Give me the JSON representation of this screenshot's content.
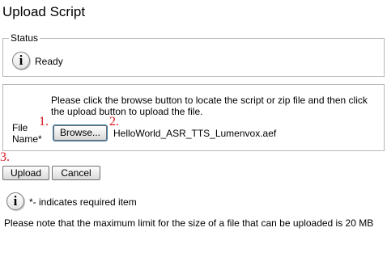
{
  "page": {
    "title": "Upload Script"
  },
  "status": {
    "legend": "Status",
    "text": "Ready"
  },
  "upload": {
    "instructions_line1": "Please click the browse button to locate the script or zip file and then click",
    "instructions_line2": "the upload button to upload the file.",
    "file_label_line1": "File",
    "file_label_line2": "Name*",
    "browse_label": "Browse...",
    "file_name": "HelloWorld_ASR_TTS_Lumenvox.aef"
  },
  "annotations": {
    "m1": "1.",
    "m2": "2.",
    "m3": "3."
  },
  "actions": {
    "upload_label": "Upload",
    "cancel_label": "Cancel"
  },
  "notes": {
    "required": "*- indicates required item",
    "limit": "Please note that the maximum limit for the size of a file that can be uploaded is 20 MB"
  },
  "icons": {
    "info": "info-icon"
  },
  "colors": {
    "border": "#b8b8b8",
    "marker": "#d7191c",
    "focus": "#3c7fb1"
  }
}
